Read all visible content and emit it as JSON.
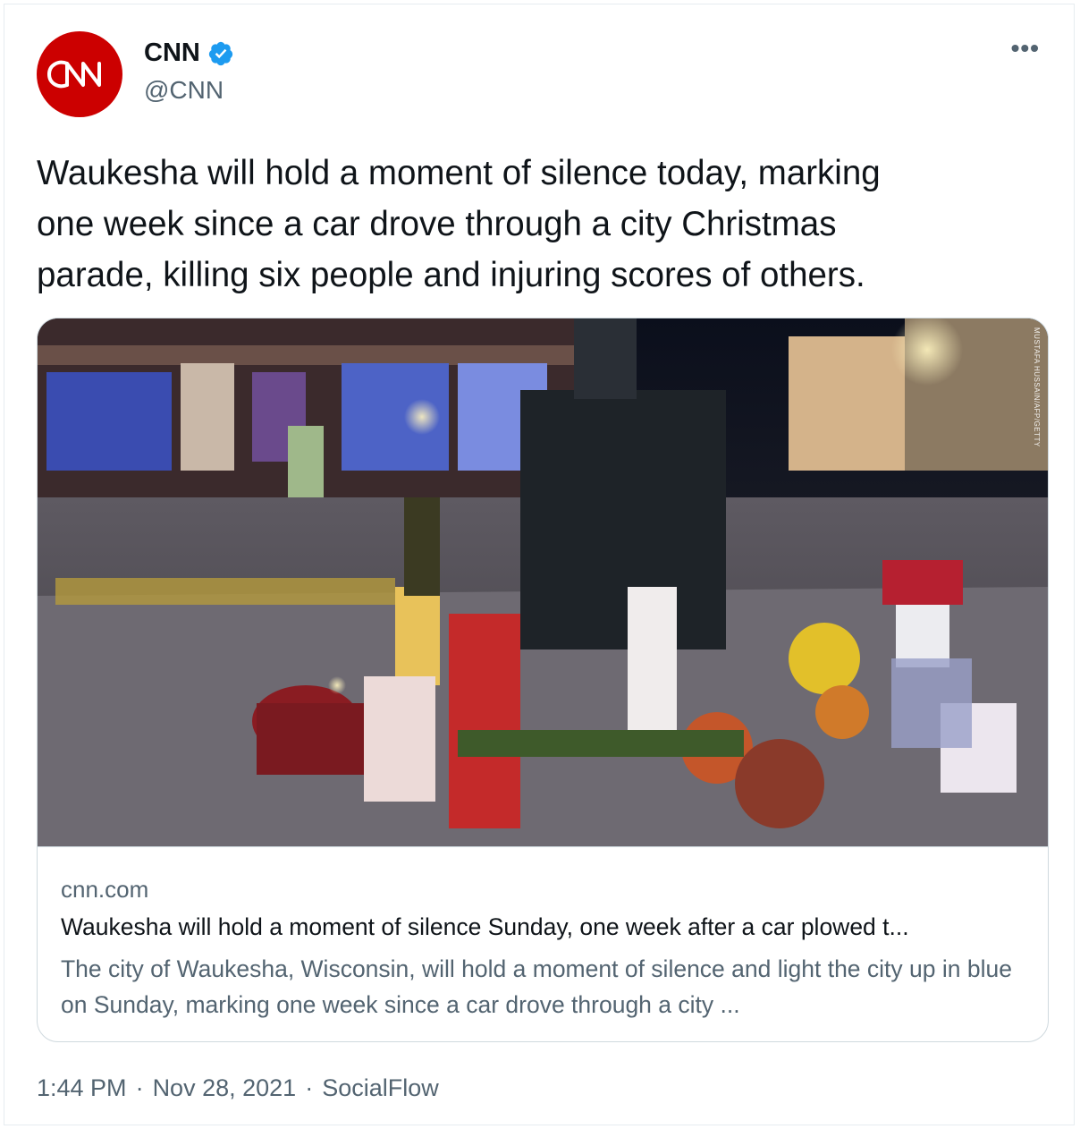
{
  "author": {
    "display_name": "CNN",
    "handle": "@CNN",
    "avatar_text": "CNN",
    "avatar_color": "#cc0000",
    "verified_color": "#1d9bf0"
  },
  "more_label": "•••",
  "tweet_text": "Waukesha will hold a moment of silence today, marking\none week since a car drove through a city Christmas\nparade, killing six people and injuring scores of others.",
  "card": {
    "photo_credit": "MUSTAFA HUSSAIN/AFP/GETTY",
    "domain": "cnn.com",
    "title": "Waukesha will hold a moment of silence Sunday, one week after a car plowed t...",
    "description": "The city of Waukesha, Wisconsin, will hold a moment of silence and light the city up in blue on Sunday, marking one week since a car drove through a city ..."
  },
  "meta": {
    "time": "1:44 PM",
    "separator": "·",
    "date": "Nov 28, 2021",
    "source": "SocialFlow"
  },
  "colors": {
    "text_primary": "#0f1419",
    "text_secondary": "#536471",
    "border": "#cfd9de"
  }
}
